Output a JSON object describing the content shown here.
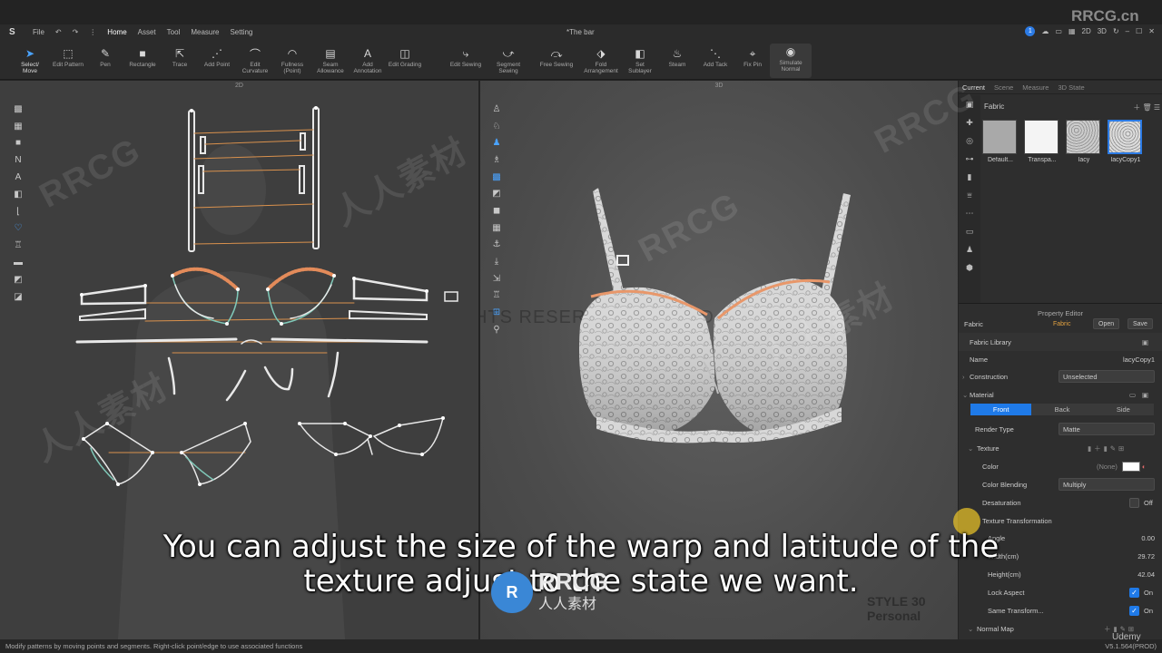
{
  "titlebar": {
    "menu": [
      "File",
      "Home",
      "Asset",
      "Tool",
      "Measure",
      "Setting"
    ],
    "active_menu": "Home",
    "document_title": "*The bar",
    "notification_count": "1",
    "view_modes": [
      "2D",
      "3D"
    ]
  },
  "toolbar": {
    "tools": [
      {
        "label": "Select/\nMove",
        "icon": "cursor-icon"
      },
      {
        "label": "Edit Pattern",
        "icon": "edit-pattern-icon"
      },
      {
        "label": "Pen",
        "icon": "pen-icon"
      },
      {
        "label": "Rectangle",
        "icon": "rectangle-icon"
      },
      {
        "label": "Trace",
        "icon": "trace-icon"
      },
      {
        "label": "Add Point",
        "icon": "add-point-icon"
      },
      {
        "label": "Edit\nCurvature",
        "icon": "curvature-icon"
      },
      {
        "label": "Fullness\n(Point)",
        "icon": "fullness-icon"
      },
      {
        "label": "Seam\nAllowance",
        "icon": "seam-allowance-icon"
      },
      {
        "label": "Add\nAnnotation",
        "icon": "annotation-icon"
      },
      {
        "label": "Edit Grading",
        "icon": "grading-icon"
      },
      {
        "label": "Edit Sewing",
        "icon": "edit-sewing-icon"
      },
      {
        "label": "Segment\nSewing",
        "icon": "segment-sewing-icon"
      },
      {
        "label": "Free Sewing",
        "icon": "free-sewing-icon"
      },
      {
        "label": "Fold\nArrangement",
        "icon": "fold-icon"
      },
      {
        "label": "Set\nSublayer",
        "icon": "sublayer-icon"
      },
      {
        "label": "Steam",
        "icon": "steam-icon"
      },
      {
        "label": "Add Tack",
        "icon": "tack-icon"
      },
      {
        "label": "Fix Pin",
        "icon": "pin-icon"
      },
      {
        "label": "Simulate\nNormal",
        "icon": "simulate-icon"
      }
    ]
  },
  "panel2d": {
    "title": "2D"
  },
  "panel3d": {
    "title": "3D",
    "watermark": "ALL RIGHTS RESERVED",
    "brand": "Style3D"
  },
  "right_tabs": [
    "Current",
    "Scene",
    "Measure",
    "3D State"
  ],
  "fabric_library": {
    "heading": "Fabric",
    "swatches": [
      {
        "name": "Default...",
        "color": "#a9a9a9"
      },
      {
        "name": "Transpa...",
        "color": "#f4f4f4"
      },
      {
        "name": "lacy",
        "color": "#b8b8b8"
      },
      {
        "name": "lacyCopy1",
        "color": "#c4c4c4"
      }
    ]
  },
  "property_editor": {
    "title": "Property Editor",
    "fabric_label": "Fabric",
    "fabric_tag": "Fabric",
    "open_btn": "Open",
    "save_btn": "Save",
    "fabric_library_label": "Fabric Library",
    "name_label": "Name",
    "name_value": "lacyCopy1",
    "construction_label": "Construction",
    "construction_value": "Unselected",
    "material_label": "Material",
    "sides": [
      "Front",
      "Back",
      "Side"
    ],
    "active_side": "Front",
    "render_type_label": "Render Type",
    "render_type_value": "Matte",
    "texture_label": "Texture",
    "color_label": "Color",
    "color_value": "(None)",
    "color_blending_label": "Color Blending",
    "color_blending_value": "Multiply",
    "desaturation_label": "Desaturation",
    "desaturation_value": "Off",
    "texture_transformation_label": "Texture Transformation",
    "angle_label": "Angle",
    "angle_value": "0.00",
    "width_label": "Width(cm)",
    "width_value": "29.72",
    "height_label": "Height(cm)",
    "height_value": "42.04",
    "lock_aspect_label": "Lock Aspect",
    "lock_aspect_value": "On",
    "same_transform_label": "Same Transform...",
    "same_transform_value": "On",
    "normal_map_label": "Normal Map"
  },
  "statusbar": {
    "message": "Modify patterns by moving points and segments. Right-click point/edge to use associated functions",
    "version": "V5.1.564(PROD)"
  },
  "overlay": {
    "subtitle_line1": "You can adjust the size of the warp and latitude of the",
    "subtitle_line2": "texture adjust to the state we want.",
    "corner_watermark": "RRCG.cn",
    "logo_text": "RRCG",
    "logo_sub": "人人素材",
    "style_brand_line1": "STYLE 30",
    "style_brand_line2": "Personal",
    "udemy": "Udemy"
  }
}
